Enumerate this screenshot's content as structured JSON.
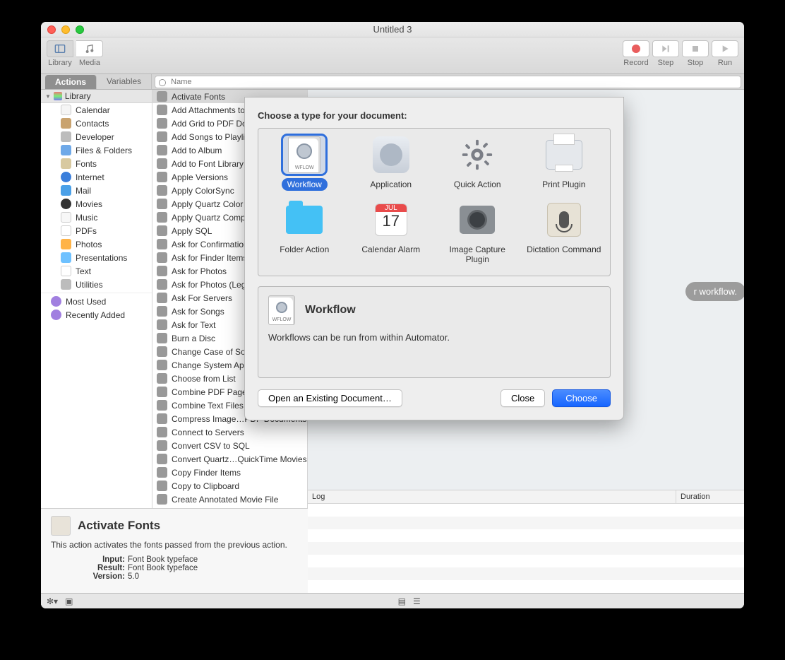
{
  "window": {
    "title": "Untitled 3"
  },
  "toolbar": {
    "library": "Library",
    "media": "Media",
    "record": "Record",
    "step": "Step",
    "stop": "Stop",
    "run": "Run"
  },
  "tabs": {
    "actions": "Actions",
    "variables": "Variables",
    "search_placeholder": "Name"
  },
  "library": {
    "header": "Library",
    "items": [
      "Calendar",
      "Contacts",
      "Developer",
      "Files & Folders",
      "Fonts",
      "Internet",
      "Mail",
      "Movies",
      "Music",
      "PDFs",
      "Photos",
      "Presentations",
      "Text",
      "Utilities"
    ],
    "footer": [
      "Most Used",
      "Recently Added"
    ]
  },
  "actions": [
    "Activate Fonts",
    "Add Attachments to Front Message",
    "Add Grid to PDF Documents",
    "Add Songs to Playlist",
    "Add to Album",
    "Add to Font Library",
    "Apple Versions",
    "Apply ColorSync",
    "Apply Quartz Color Filter",
    "Apply Quartz Composition",
    "Apply SQL",
    "Ask for Confirmation",
    "Ask for Finder Items",
    "Ask for Photos",
    "Ask for Photos (Legacy)",
    "Ask For Servers",
    "Ask for Songs",
    "Ask for Text",
    "Burn a Disc",
    "Change Case of Song Names",
    "Change System Appearance",
    "Choose from List",
    "Combine PDF Pages",
    "Combine Text Files",
    "Compress Image…PDF Documents",
    "Connect to Servers",
    "Convert CSV to SQL",
    "Convert Quartz…QuickTime Movies",
    "Copy Finder Items",
    "Copy to Clipboard",
    "Create Annotated Movie File"
  ],
  "canvas": {
    "placeholder": "r workflow."
  },
  "log": {
    "log_label": "Log",
    "duration_label": "Duration"
  },
  "info": {
    "title": "Activate Fonts",
    "desc": "This action activates the fonts passed from the previous action.",
    "input_label": "Input:",
    "input_value": "Font Book typeface",
    "result_label": "Result:",
    "result_value": "Font Book typeface",
    "version_label": "Version:",
    "version_value": "5.0"
  },
  "sheet": {
    "heading": "Choose a type for your document:",
    "types": [
      {
        "label": "Workflow",
        "selected": true
      },
      {
        "label": "Application",
        "selected": false
      },
      {
        "label": "Quick Action",
        "selected": false
      },
      {
        "label": "Print Plugin",
        "selected": false
      },
      {
        "label": "Folder Action",
        "selected": false
      },
      {
        "label": "Calendar Alarm",
        "selected": false
      },
      {
        "label": "Image Capture Plugin",
        "selected": false
      },
      {
        "label": "Dictation Command",
        "selected": false
      }
    ],
    "desc_title": "Workflow",
    "desc_body": "Workflows can be run from within Automator.",
    "open_existing": "Open an Existing Document…",
    "close": "Close",
    "choose": "Choose",
    "cal_month": "JUL",
    "cal_day": "17",
    "wflow_tag": "WFLOW"
  }
}
